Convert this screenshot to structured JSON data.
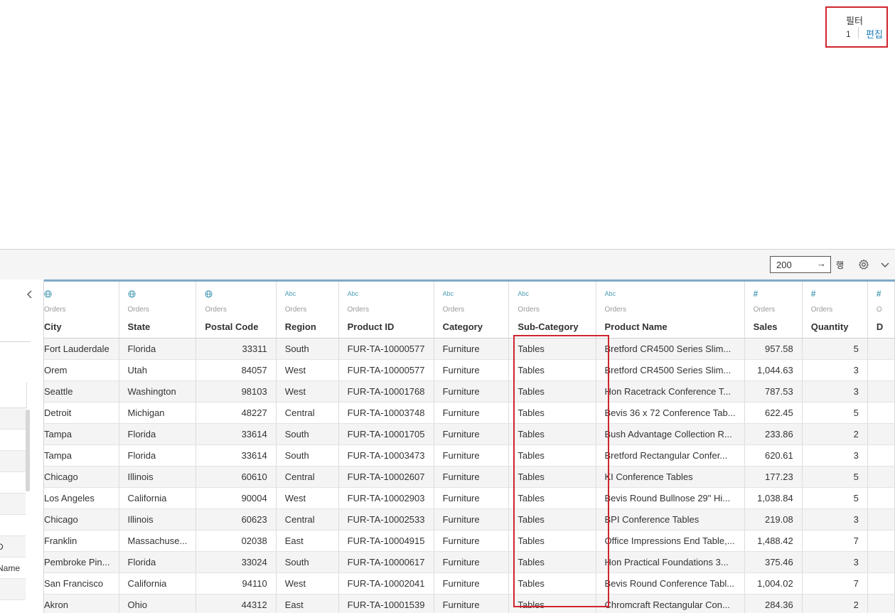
{
  "filter": {
    "title": "필터",
    "count": "1",
    "edit_label": "편집"
  },
  "toolbar": {
    "rows_value": "200",
    "rows_arrow": "→",
    "rows_label": "행",
    "settings_icon": "gear-icon",
    "menu_icon": "chevron-down-icon"
  },
  "left_pane": {
    "partial_labels": [
      "D",
      "Name"
    ],
    "collapse_icon": "chevron-left-icon"
  },
  "colors": {
    "highlight": "#d0242e",
    "link": "#1a7ab8",
    "type_icon": "#4b9cb4",
    "header_bar": "#7fa9c6",
    "row_shade": "#f4f4f4"
  },
  "columns": [
    {
      "name": "City",
      "source": "Orders",
      "type_icon": "globe-icon",
      "type_text": ""
    },
    {
      "name": "State",
      "source": "Orders",
      "type_icon": "globe-icon",
      "type_text": ""
    },
    {
      "name": "Postal Code",
      "source": "Orders",
      "type_icon": "globe-icon",
      "type_text": ""
    },
    {
      "name": "Region",
      "source": "Orders",
      "type_icon": "abc-icon",
      "type_text": "Abc"
    },
    {
      "name": "Product ID",
      "source": "Orders",
      "type_icon": "abc-icon",
      "type_text": "Abc"
    },
    {
      "name": "Category",
      "source": "Orders",
      "type_icon": "abc-icon",
      "type_text": "Abc"
    },
    {
      "name": "Sub-Category",
      "source": "Orders",
      "type_icon": "abc-icon",
      "type_text": "Abc"
    },
    {
      "name": "Product Name",
      "source": "Orders",
      "type_icon": "abc-icon",
      "type_text": "Abc"
    },
    {
      "name": "Sales",
      "source": "Orders",
      "type_icon": "number-icon",
      "type_text": "#"
    },
    {
      "name": "Quantity",
      "source": "Orders",
      "type_icon": "number-icon",
      "type_text": "#"
    },
    {
      "name": "D",
      "source": "O",
      "type_icon": "number-icon",
      "type_text": "#"
    }
  ],
  "rows": [
    [
      "Fort Lauderdale",
      "Florida",
      "33311",
      "South",
      "FUR-TA-10000577",
      "Furniture",
      "Tables",
      "Bretford CR4500 Series Slim...",
      "957.58",
      "5",
      ""
    ],
    [
      "Orem",
      "Utah",
      "84057",
      "West",
      "FUR-TA-10000577",
      "Furniture",
      "Tables",
      "Bretford CR4500 Series Slim...",
      "1,044.63",
      "3",
      ""
    ],
    [
      "Seattle",
      "Washington",
      "98103",
      "West",
      "FUR-TA-10001768",
      "Furniture",
      "Tables",
      "Hon Racetrack Conference T...",
      "787.53",
      "3",
      ""
    ],
    [
      "Detroit",
      "Michigan",
      "48227",
      "Central",
      "FUR-TA-10003748",
      "Furniture",
      "Tables",
      "Bevis 36 x 72 Conference Tab...",
      "622.45",
      "5",
      ""
    ],
    [
      "Tampa",
      "Florida",
      "33614",
      "South",
      "FUR-TA-10001705",
      "Furniture",
      "Tables",
      "Bush Advantage Collection R...",
      "233.86",
      "2",
      ""
    ],
    [
      "Tampa",
      "Florida",
      "33614",
      "South",
      "FUR-TA-10003473",
      "Furniture",
      "Tables",
      "Bretford Rectangular Confer...",
      "620.61",
      "3",
      ""
    ],
    [
      "Chicago",
      "Illinois",
      "60610",
      "Central",
      "FUR-TA-10002607",
      "Furniture",
      "Tables",
      "KI Conference Tables",
      "177.23",
      "5",
      ""
    ],
    [
      "Los Angeles",
      "California",
      "90004",
      "West",
      "FUR-TA-10002903",
      "Furniture",
      "Tables",
      "Bevis Round Bullnose 29\" Hi...",
      "1,038.84",
      "5",
      ""
    ],
    [
      "Chicago",
      "Illinois",
      "60623",
      "Central",
      "FUR-TA-10002533",
      "Furniture",
      "Tables",
      "BPI Conference Tables",
      "219.08",
      "3",
      ""
    ],
    [
      "Franklin",
      "Massachuse...",
      "02038",
      "East",
      "FUR-TA-10004915",
      "Furniture",
      "Tables",
      "Office Impressions End Table,...",
      "1,488.42",
      "7",
      ""
    ],
    [
      "Pembroke Pin...",
      "Florida",
      "33024",
      "South",
      "FUR-TA-10000617",
      "Furniture",
      "Tables",
      "Hon Practical Foundations 3...",
      "375.46",
      "3",
      ""
    ],
    [
      "San Francisco",
      "California",
      "94110",
      "West",
      "FUR-TA-10002041",
      "Furniture",
      "Tables",
      "Bevis Round Conference Tabl...",
      "1,004.02",
      "7",
      ""
    ],
    [
      "Akron",
      "Ohio",
      "44312",
      "East",
      "FUR-TA-10001539",
      "Furniture",
      "Tables",
      "Chromcraft Rectangular Con...",
      "284.36",
      "2",
      ""
    ]
  ]
}
